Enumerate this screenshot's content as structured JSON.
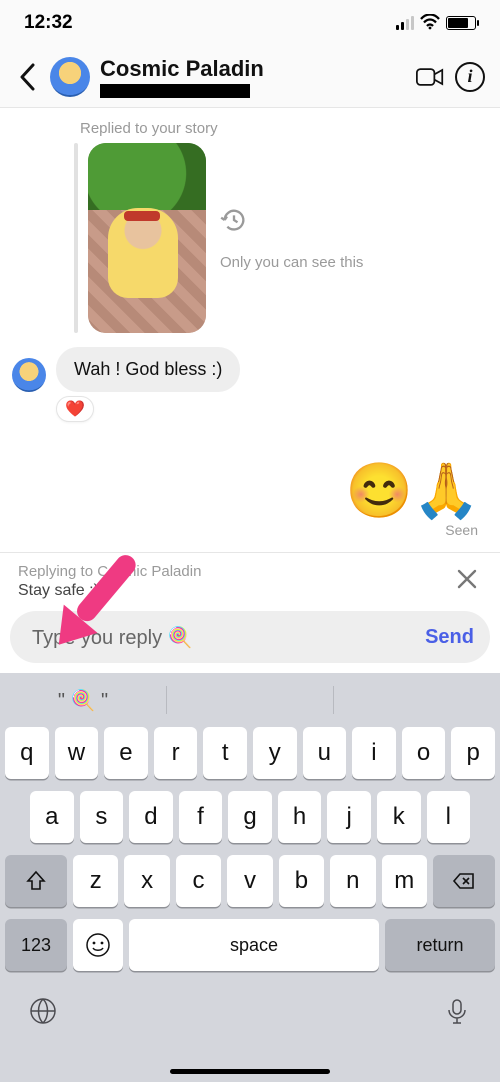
{
  "status": {
    "time": "12:32"
  },
  "header": {
    "name": "Cosmic Paladin"
  },
  "chat": {
    "replied_label": "Replied to your story",
    "privacy_note": "Only you can see this",
    "message": "Wah ! God bless :)",
    "reaction": "❤️",
    "emoji_reply": "😊🙏",
    "seen": "Seen"
  },
  "reply": {
    "label": "Replying to Cosmic Paladin",
    "quoted": "Stay safe :)"
  },
  "composer": {
    "placeholder": "Type you reply 🍭",
    "send": "Send"
  },
  "keyboard": {
    "suggestion": "\" 🍭 \"",
    "row1": [
      "q",
      "w",
      "e",
      "r",
      "t",
      "y",
      "u",
      "i",
      "o",
      "p"
    ],
    "row2": [
      "a",
      "s",
      "d",
      "f",
      "g",
      "h",
      "j",
      "k",
      "l"
    ],
    "row3": [
      "z",
      "x",
      "c",
      "v",
      "b",
      "n",
      "m"
    ],
    "numkey": "123",
    "space": "space",
    "return": "return"
  }
}
